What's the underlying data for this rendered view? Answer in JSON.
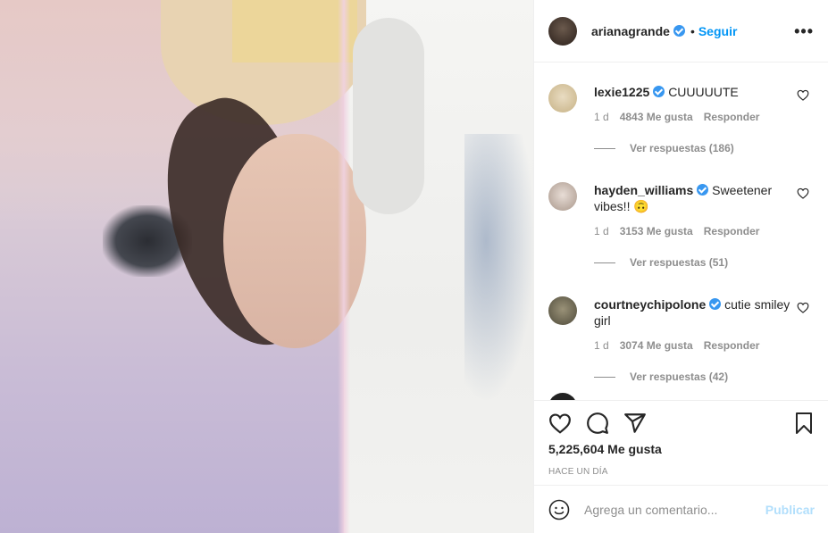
{
  "header": {
    "username": "arianagrande",
    "separator": "•",
    "follow_label": "Seguir",
    "more_label": "•••"
  },
  "comments": [
    {
      "user": "lexie1225",
      "text": "CUUUUUTE",
      "age": "1 d",
      "likes": "4843 Me gusta",
      "reply": "Responder",
      "view_replies": "Ver respuestas (186)",
      "avatar_color": "#d9c8a2"
    },
    {
      "user": "hayden_williams",
      "text": "Sweetener vibes!! 🙃",
      "age": "1 d",
      "likes": "3153 Me gusta",
      "reply": "Responder",
      "view_replies": "Ver respuestas (51)",
      "avatar_color": "#b9a89c"
    },
    {
      "user": "courtneychipolone",
      "text": "cutie smiley girl",
      "age": "1 d",
      "likes": "3074 Me gusta",
      "reply": "Responder",
      "view_replies": "Ver respuestas (42)",
      "avatar_color": "#6f6a56"
    }
  ],
  "actions": {
    "icons": [
      "heart-icon",
      "comment-icon",
      "share-icon",
      "bookmark-icon"
    ],
    "likes": "5,225,604 Me gusta",
    "time": "Hace un día"
  },
  "comment_box": {
    "emoji_icon": "emoji-icon",
    "placeholder": "Agrega un comentario...",
    "post_label": "Publicar"
  },
  "colors": {
    "link_blue": "#0095f6",
    "verified_blue": "#3897f0",
    "muted": "#8e8e8e",
    "post_disabled": "#b2dffc"
  }
}
